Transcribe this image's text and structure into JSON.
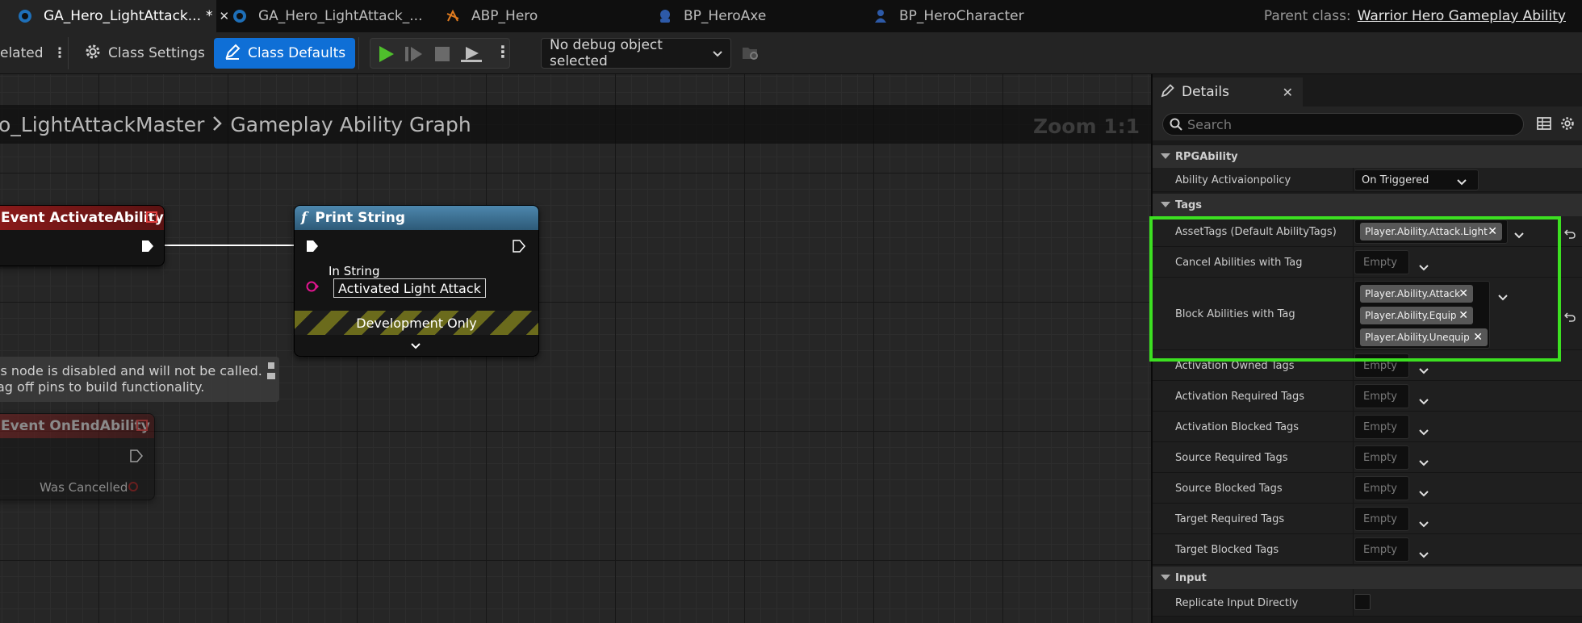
{
  "tabs": [
    {
      "label": "GA_Hero_LightAttack...",
      "modified": "*",
      "close": "✕",
      "active": true,
      "icon": "blueprint-icon"
    },
    {
      "label": "GA_Hero_LightAttack_...",
      "active": false,
      "icon": "blueprint-icon"
    },
    {
      "label": "ABP_Hero",
      "active": false,
      "icon": "anim-blueprint-icon"
    },
    {
      "label": "BP_HeroAxe",
      "active": false,
      "icon": "actor-blueprint-icon"
    },
    {
      "label": "BP_HeroCharacter",
      "active": false,
      "icon": "character-blueprint-icon"
    }
  ],
  "parent_class": {
    "label": "Parent class:",
    "value": "Warrior Hero Gameplay Ability"
  },
  "toolbar": {
    "related_label": "elated",
    "class_settings": "Class Settings",
    "class_defaults": "Class Defaults",
    "debug_select": "No debug object selected"
  },
  "graph": {
    "breadcrumb_parent": "o_LightAttackMaster",
    "breadcrumb_current": "Gameplay Ability Graph",
    "zoom": "Zoom 1:1",
    "nodes": {
      "activate": {
        "title": "Event ActivateAbility"
      },
      "print": {
        "title": "Print String",
        "pin_label": "In String",
        "pin_value": "Activated Light Attack",
        "dev_only": "Development Only"
      },
      "end": {
        "title": "Event OnEndAbility",
        "pin_label": "Was Cancelled"
      }
    },
    "warning_lines": [
      "is node is disabled and will not be called.",
      "ag off pins to build functionality."
    ]
  },
  "details": {
    "tab_title": "Details",
    "search_placeholder": "Search",
    "categories": {
      "rpg": "RPGAbility",
      "tags": "Tags",
      "input": "Input"
    },
    "activation_policy": {
      "label": "Ability Activaionpolicy",
      "value": "On Triggered"
    },
    "asset_tags": {
      "label": "AssetTags (Default AbilityTags)",
      "tags": [
        "Player.Ability.Attack.Light"
      ]
    },
    "cancel": {
      "label": "Cancel Abilities with Tag",
      "value": "Empty"
    },
    "block": {
      "label": "Block Abilities with Tag",
      "tags": [
        "Player.Ability.Attack",
        "Player.Ability.Equip",
        "Player.Ability.Unequip"
      ]
    },
    "empty_rows": [
      {
        "label": "Activation Owned Tags",
        "value": "Empty"
      },
      {
        "label": "Activation Required Tags",
        "value": "Empty"
      },
      {
        "label": "Activation Blocked Tags",
        "value": "Empty"
      },
      {
        "label": "Source Required Tags",
        "value": "Empty"
      },
      {
        "label": "Source Blocked Tags",
        "value": "Empty"
      },
      {
        "label": "Target Required Tags",
        "value": "Empty"
      },
      {
        "label": "Target Blocked Tags",
        "value": "Empty"
      }
    ],
    "replicate": {
      "label": "Replicate Input Directly",
      "checked": false
    }
  },
  "colors": {
    "accent": "#0f6fd6",
    "highlight": "#3ce021",
    "event_header": "#8b1a1a",
    "function_header": "#3a6e8f"
  }
}
